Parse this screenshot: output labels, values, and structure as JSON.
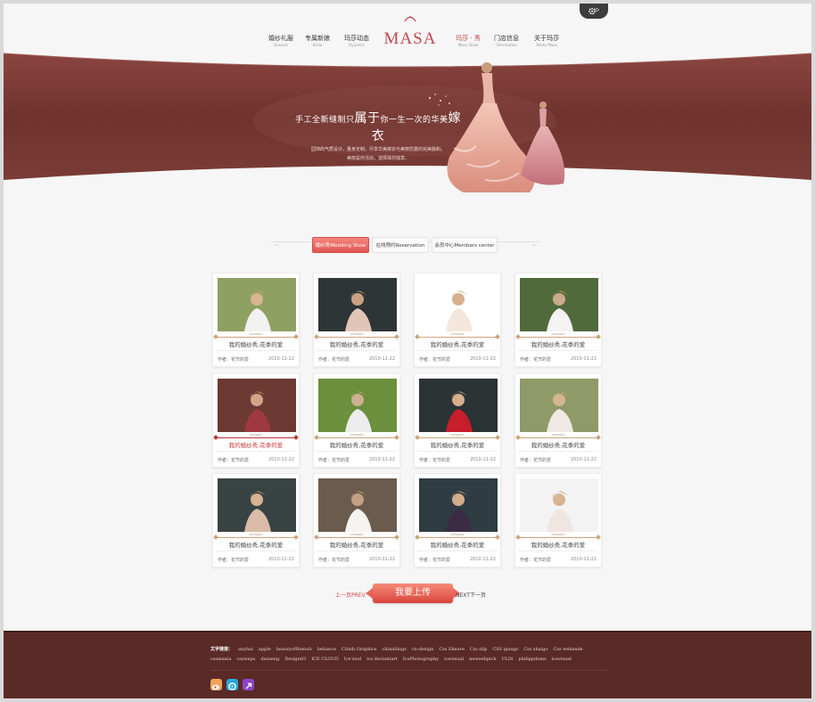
{
  "colors": {
    "accent": "#e05552",
    "banner": "#7a3a34",
    "footer": "#5a2a27"
  },
  "settings_icon": "gear-icon",
  "logo": {
    "text": "MASA"
  },
  "nav": [
    {
      "cn": "婚纱礼服",
      "en": "Dresses"
    },
    {
      "cn": "专属新娘",
      "en": "Bride"
    },
    {
      "cn": "玛莎动态",
      "en": "Dynamic"
    },
    {
      "cn": "玛莎 · 秀",
      "en": "Masa Show"
    },
    {
      "cn": "门店信息",
      "en": "Information"
    },
    {
      "cn": "关于玛莎",
      "en": "Abotu Masa"
    }
  ],
  "banner": {
    "title_pre": "手工全新缝制只",
    "title_big1": "属于",
    "title_mid": "你一生一次的华美",
    "title_big2": "嫁衣",
    "subtitle_1": "园饰的气质设计，量身定制。尽享华美嫁衣与美丽优雅的完美融和。",
    "subtitle_2": "美丽是你活动，选择珠你独享。"
  },
  "tabs": [
    {
      "label": "婚纱秀Wedding Show"
    },
    {
      "label": "在线预约Reservation"
    },
    {
      "label": "会员中心Members center"
    }
  ],
  "cards": [
    {
      "tag": "campple",
      "title": "我的婚纱秀,花季的爱",
      "author": "作者：花节的爱",
      "date": "2010-11-22"
    },
    {
      "tag": "campple",
      "title": "我的婚纱秀,花季的爱",
      "author": "作者：花节的爱",
      "date": "2010-11-22"
    },
    {
      "tag": "campple",
      "title": "我的婚纱秀,花季的爱",
      "author": "作者：花节的爱",
      "date": "2010-11-22"
    },
    {
      "tag": "campple",
      "title": "我的婚纱秀,花季的爱",
      "author": "作者：花节的爱",
      "date": "2010-11-22"
    },
    {
      "tag": "campple",
      "title": "我的婚纱秀,花季的爱",
      "author": "作者：花节的爱",
      "date": "2010-11-22"
    },
    {
      "tag": "campple",
      "title": "我的婚纱秀,花季的爱",
      "author": "作者：花节的爱",
      "date": "2010-11-22"
    },
    {
      "tag": "campple",
      "title": "我的婚纱秀,花季的爱",
      "author": "作者：花节的爱",
      "date": "2010-11-22"
    },
    {
      "tag": "campple",
      "title": "我的婚纱秀,花季的爱",
      "author": "作者：花节的爱",
      "date": "2010-11-22"
    },
    {
      "tag": "campple",
      "title": "我的婚纱秀,花季的爱",
      "author": "作者：花节的爱",
      "date": "2010-11-22"
    },
    {
      "tag": "campple",
      "title": "我的婚纱秀,花季的爱",
      "author": "作者：花节的爱",
      "date": "2010-11-22"
    },
    {
      "tag": "campple",
      "title": "我的婚纱秀,花季的爱",
      "author": "作者：花节的爱",
      "date": "2010-11-22"
    },
    {
      "tag": "campple",
      "title": "我的婚纱秀,花季的爱",
      "author": "作者：花节的爱",
      "date": "2010-11-22"
    }
  ],
  "pagination": {
    "prev": "上一页PREV",
    "upload": "我要上传",
    "next": "NEXT下一页"
  },
  "footer": {
    "label": "文字链接：",
    "links_row1": [
      "anyhai",
      "apple",
      "beautyofthenub",
      "behance",
      "Chinh Graphics",
      "chinablogs",
      "cn-design",
      "Css Sheare",
      "Css slip",
      "CSS igusgo",
      "Css shaigo",
      "Css wekande"
    ],
    "links_row2": [
      "cssmania",
      "csswaps",
      "dazzeng",
      "Design83",
      "ICE CLOUD",
      "Ice'zool",
      "ics deviantart",
      "IcePhotography",
      "icevisual",
      "neweebpick",
      "ULDi",
      "philippdoms",
      "icevisual"
    ],
    "social": [
      "weibo-icon",
      "tencent-icon",
      "link-icon"
    ]
  }
}
